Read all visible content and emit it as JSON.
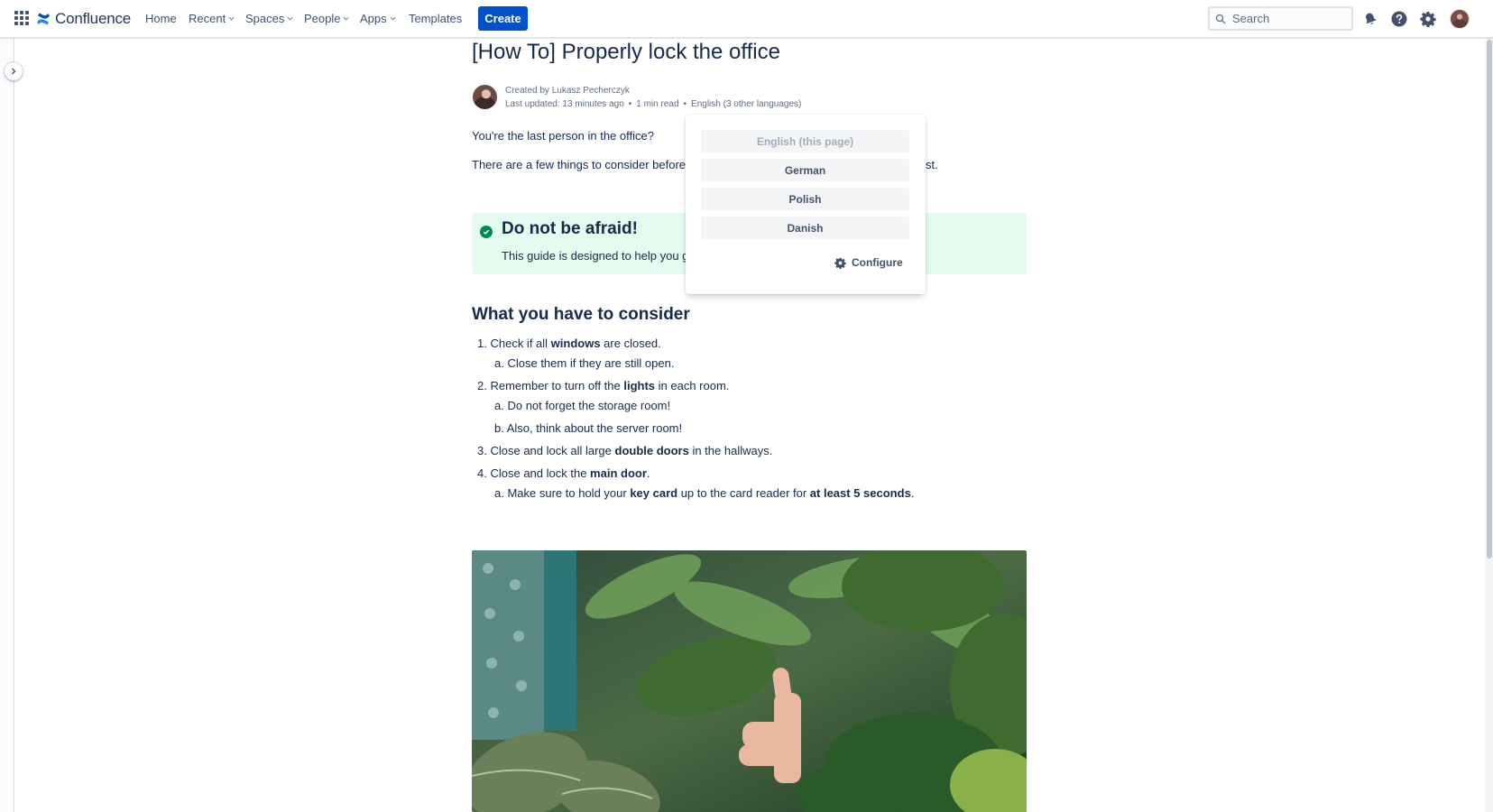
{
  "nav": {
    "product": "Confluence",
    "items": [
      {
        "label": "Home",
        "has_dropdown": false
      },
      {
        "label": "Recent",
        "has_dropdown": true
      },
      {
        "label": "Spaces",
        "has_dropdown": true
      },
      {
        "label": "People",
        "has_dropdown": true
      },
      {
        "label": "Apps",
        "has_dropdown": true
      },
      {
        "label": "Templates",
        "has_dropdown": false
      }
    ],
    "create_label": "Create",
    "search_placeholder": "Search"
  },
  "page": {
    "title": "[How To] Properly lock the office",
    "byline": {
      "created_prefix": "Created by ",
      "author": "Lukasz Pecherczyk",
      "last_updated": "Last updated: 13 minutes ago",
      "read_time": "1 min read",
      "language": "English (3 other languages)"
    },
    "intro_1": "You're the last person in the office?",
    "intro_2_start": "There are a few things to consider before",
    "intro_2_end": "st.",
    "panel": {
      "title": "Do not be afraid!",
      "text_visible": "This guide is designed to help you g"
    },
    "section_heading": "What you have to consider",
    "steps": {
      "s1_num": "1.",
      "s1_a": "Check if all ",
      "s1_b": "windows",
      "s1_c": " are closed.",
      "s1a_num": "a.",
      "s1a": "Close them if they are still open.",
      "s2_num": "2.",
      "s2_a": "Remember to turn off the ",
      "s2_b": "lights",
      "s2_c": " in each room.",
      "s2a_num": "a.",
      "s2a": "Do not forget the storage room!",
      "s2b_num": "b.",
      "s2b": "Also, think about the server room!",
      "s3_num": "3.",
      "s3_a": "Close and lock all large ",
      "s3_b": "double doors",
      "s3_c": " in the hallways.",
      "s4_num": "4.",
      "s4_a": "Close and lock the ",
      "s4_b": "main door",
      "s4_c": ".",
      "s4a_num": "a.",
      "s4a_a": "Make sure to hold your ",
      "s4a_b": "key card",
      "s4a_c": " up to the card reader for ",
      "s4a_d": "at least 5 seconds",
      "s4a_e": "."
    }
  },
  "language_menu": {
    "options": [
      {
        "label": "English (this page)",
        "disabled": true
      },
      {
        "label": "German",
        "disabled": false
      },
      {
        "label": "Polish",
        "disabled": false
      },
      {
        "label": "Danish",
        "disabled": false
      }
    ],
    "configure_label": "Configure"
  },
  "colors": {
    "brand_blue": "#0052cc",
    "panel_success_bg": "#e3fcef",
    "success_icon": "#00875a"
  }
}
